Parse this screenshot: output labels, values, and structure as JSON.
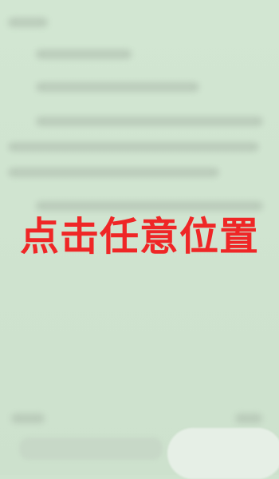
{
  "screen": {
    "hint_text": "点击任意位置"
  },
  "colors": {
    "background": "#cfe3cf",
    "hint": "#ef2626"
  }
}
